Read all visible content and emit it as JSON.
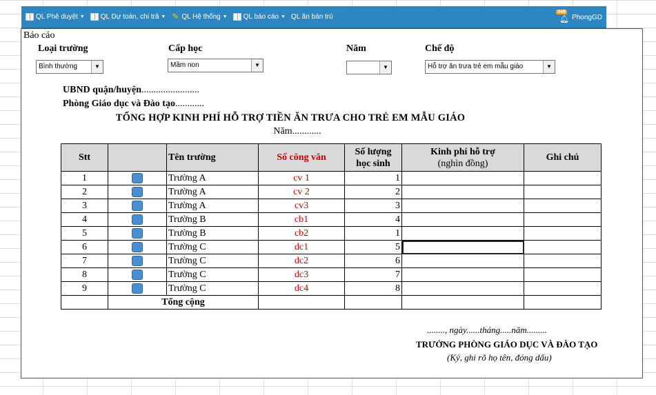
{
  "menu": {
    "items": [
      {
        "label": "QL Phê duyệt",
        "icon": "book-icon",
        "caret": "▼"
      },
      {
        "label": "QL Dự toán, chi trả",
        "icon": "book-icon",
        "caret": "▼"
      },
      {
        "label": "QL Hệ thống",
        "icon": "wrench-icon",
        "caret": "▼"
      },
      {
        "label": "QL báo cáo",
        "icon": "book-icon",
        "caret": "▼"
      },
      {
        "label": "QL ăn bán trú",
        "icon": "",
        "caret": ""
      }
    ],
    "notification_count": "348",
    "username": "PhongGD"
  },
  "report": {
    "label": "Báo cáo",
    "filters": {
      "school_type": {
        "label": "Loại trường",
        "value": "Bình thường"
      },
      "level": {
        "label": "Cấp học",
        "value": "Mầm non"
      },
      "year": {
        "label": "Năm",
        "value": ""
      },
      "policy": {
        "label": "Chế độ",
        "value": "Hỗ trợ ăn trưa trẻ em mẫu giáo"
      }
    },
    "header_line1_label": "UBND quận/huyện",
    "header_line1_dots": "........................",
    "header_line2_label": "Phòng Giáo dục và Đào tạo",
    "header_line2_dots": "............",
    "title": "TỔNG HỢP KINH PHÍ HỖ TRỢ TIỀN ĂN TRƯA CHO TRẺ EM MẪU GIÁO",
    "year_line": "Năm............"
  },
  "table": {
    "headers": {
      "stt": "Stt",
      "icon": "",
      "school": "Tên trường",
      "doc": "Số công văn",
      "students_l1": "Số lượng",
      "students_l2": "học sinh",
      "funding_l1": "Kinh phí hỗ trợ",
      "funding_l2": "(nghìn đồng)",
      "note": "Ghi chú"
    },
    "rows": [
      {
        "stt": "1",
        "school": "Trường A",
        "doc": "cv 1",
        "students": "1",
        "funding": "",
        "note": ""
      },
      {
        "stt": "2",
        "school": "Trường A",
        "doc": "cv 2",
        "students": "2",
        "funding": "",
        "note": ""
      },
      {
        "stt": "3",
        "school": "Trường A",
        "doc": "cv3",
        "students": "3",
        "funding": "",
        "note": ""
      },
      {
        "stt": "4",
        "school": "Trường B",
        "doc": "cb1",
        "students": "4",
        "funding": "",
        "note": ""
      },
      {
        "stt": "5",
        "school": "Trường B",
        "doc": "cb2",
        "students": "1",
        "funding": "",
        "note": ""
      },
      {
        "stt": "6",
        "school": "Trường C",
        "doc": "dc1",
        "students": "5",
        "funding": "",
        "note": ""
      },
      {
        "stt": "7",
        "school": "Trường C",
        "doc": "dc2",
        "students": "6",
        "funding": "",
        "note": ""
      },
      {
        "stt": "8",
        "school": "Trường C",
        "doc": "dc3",
        "students": "7",
        "funding": "",
        "note": ""
      },
      {
        "stt": "9",
        "school": "Trường C",
        "doc": "dc4",
        "students": "8",
        "funding": "",
        "note": ""
      }
    ],
    "total_label": "Tổng cộng"
  },
  "footer": {
    "date_line": "........, ngày......tháng.....năm.........",
    "signer": "TRƯỞNG PHÒNG GIÁO DỤC VÀ ĐÀO TẠO",
    "sign_note": "(Ký, ghi rõ họ tên, đóng dấu)"
  },
  "colors": {
    "menu_bar": "#2e86c1",
    "header_fill": "#d9d9d9",
    "doc_text": "#d00000",
    "row_icon": "#4a8fd1"
  }
}
